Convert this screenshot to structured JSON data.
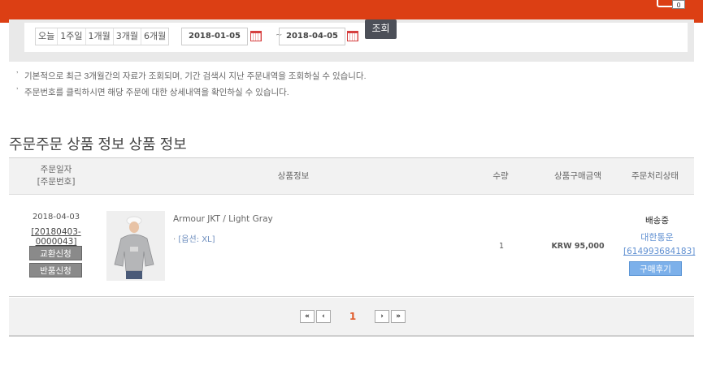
{
  "header": {
    "cart_count": "0"
  },
  "search": {
    "periods": [
      "오늘",
      "1주일",
      "1개월",
      "3개월",
      "6개월"
    ],
    "start_date": "2018-01-05",
    "end_date": "2018-04-05",
    "separator": "~",
    "query_label": "조회"
  },
  "notes": [
    "기본적으로 최근 3개월간의 자료가 조회되며, 기간 검색시 지난 주문내역을 조회하실 수 있습니다.",
    "주문번호를 클릭하시면 해당 주문에 대한 상세내역을 확인하실 수 있습니다."
  ],
  "section_title": "주문주문 상품 정보 상품 정보",
  "table": {
    "headers": {
      "date_line1": "주문일자",
      "date_line2": "[주문번호]",
      "product": "상품정보",
      "qty": "수량",
      "price": "상품구매금액",
      "status": "주문처리상태"
    },
    "rows": [
      {
        "date": "2018-04-03",
        "order_number": "[20180403-0000043]",
        "exchange_label": "교환신청",
        "return_label": "반품신청",
        "product_name": "Armour JKT / Light Gray",
        "option": "[옵션: XL]",
        "qty": "1",
        "price": "KRW 95,000",
        "status": "배송중",
        "carrier": "대한통운",
        "tracking": "[614993684183]",
        "review_label": "구매후기"
      }
    ]
  },
  "pagination": {
    "first": "«",
    "prev": "‹",
    "current": "1",
    "next": "›",
    "last": "»"
  }
}
